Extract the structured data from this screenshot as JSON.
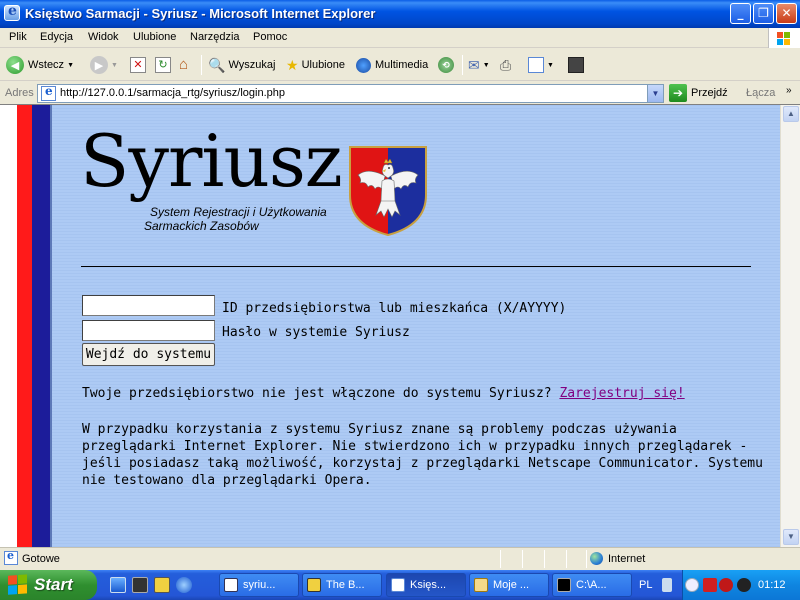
{
  "window": {
    "title": "Księstwo Sarmacji - Syriusz - Microsoft Internet Explorer",
    "min_icon": "minimize-icon",
    "max_icon": "maximize-icon",
    "close_icon": "close-icon"
  },
  "menu": [
    "Plik",
    "Edycja",
    "Widok",
    "Ulubione",
    "Narzędzia",
    "Pomoc"
  ],
  "toolbar": {
    "back_label": "Wstecz",
    "search_label": "Wyszukaj",
    "favorites_label": "Ulubione",
    "multimedia_label": "Multimedia"
  },
  "address": {
    "label": "Adres",
    "url": "http://127.0.0.1/sarmacja_rtg/syriusz/login.php",
    "go_label": "Przejdź",
    "links_label": "Łącza"
  },
  "page": {
    "logo_title": "Syriusz",
    "logo_sub1": "System Rejestracji i Użytkowania",
    "logo_sub2": "Sarmackich Zasobów",
    "id_label": "ID przedsiębiorstwa lub mieszkańca (X/AYYYY)",
    "password_label": "Hasło w systemie Syriusz",
    "id_value": "",
    "password_value": "",
    "login_button": "Wejdź do systemu",
    "notice_text": "Twoje przedsiębiorstwo nie jest włączone do systemu Syriusz?",
    "register_link": "Zarejestruj się!",
    "info_text": "W przypadku korzystania z systemu Syriusz znane są problemy podczas używania przeglądarki Internet Explorer. Nie stwierdzono ich w przypadku innych przeglądarek - jeśli posiadasz taką możliwość, korzystaj z przeglądarki Netscape Communicator. Systemu nie testowano dla przeglądarki Opera."
  },
  "colors": {
    "stripe_red": "#ff1a1a",
    "stripe_blue": "#1c1c9a",
    "page_bg": "#a9c7f2",
    "link_visited": "#800080"
  },
  "status": {
    "text": "Gotowe",
    "zone": "Internet"
  },
  "taskbar": {
    "start_label": "Start",
    "tasks": [
      "syriu...",
      "The B...",
      "Księs...",
      "Moje ...",
      "C:\\A..."
    ],
    "active_task_index": 2,
    "language": "PL",
    "clock": "01:12"
  }
}
